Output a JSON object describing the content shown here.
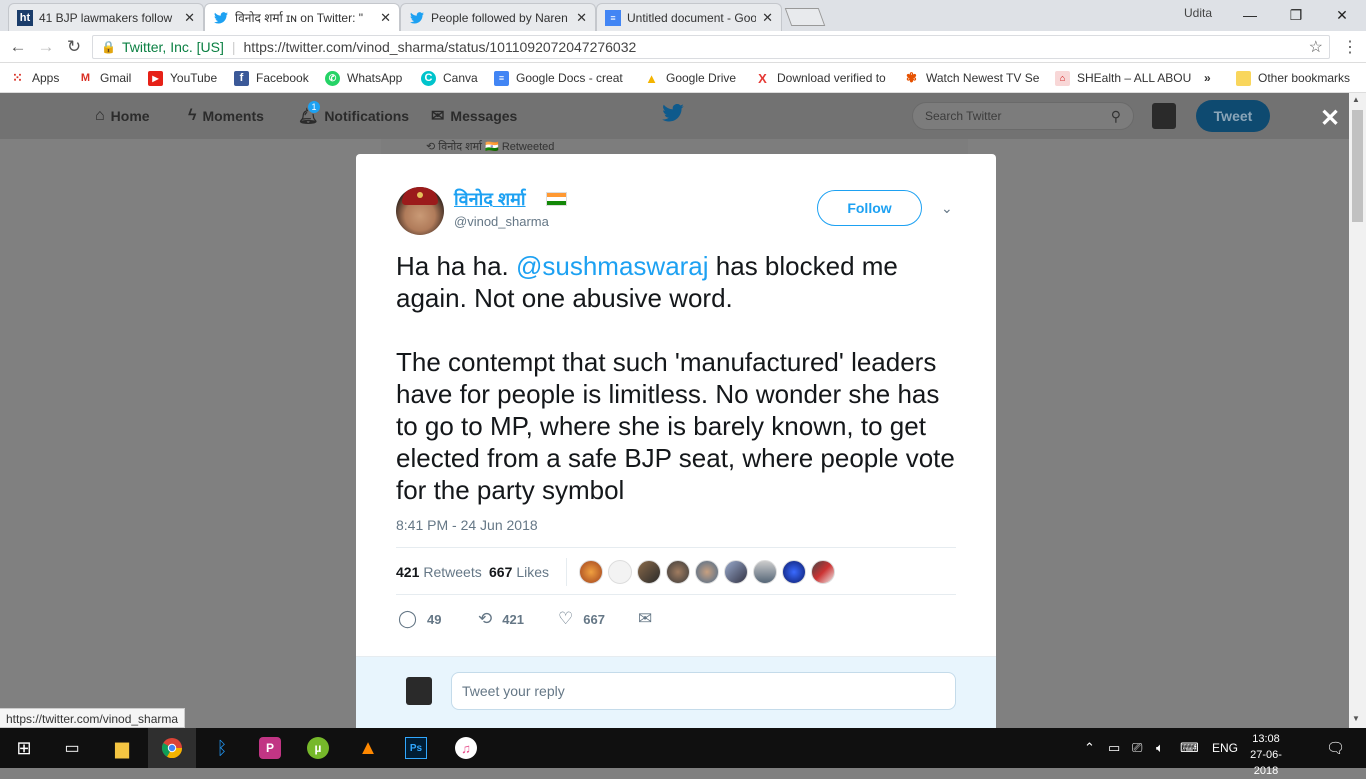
{
  "browser": {
    "tabs": [
      {
        "title": "41 BJP lawmakers follow",
        "favicon": "ht",
        "active": false
      },
      {
        "title": "विनोद शर्मा ɪɴ on Twitter: \"",
        "favicon": "twitter-bird",
        "active": true
      },
      {
        "title": "People followed by Naren",
        "favicon": "twitter-bird",
        "active": false
      },
      {
        "title": "Untitled document - Goo",
        "favicon": "docs",
        "active": false
      }
    ],
    "window_user": "Udita",
    "security_label": "Twitter, Inc. [US]",
    "url": "https://twitter.com/vinod_sharma/status/1011092072047276032",
    "bookmarks": [
      "Apps",
      "Gmail",
      "YouTube",
      "Facebook",
      "WhatsApp",
      "Canva",
      "Google Docs - creat",
      "Google Drive",
      "Download verified to",
      "Watch Newest TV Se",
      "SHEalth – ALL ABOU",
      "»",
      "Other bookmarks"
    ]
  },
  "twitter_nav": {
    "home": "Home",
    "moments": "Moments",
    "notifications": "Notifications",
    "notification_count": "1",
    "messages": "Messages",
    "search_placeholder": "Search Twitter",
    "tweet_button": "Tweet"
  },
  "behind_strip": "विनोद शर्मा 🇮🇳 Retweeted",
  "tweet": {
    "display_name": "विनोद शर्मा",
    "handle": "@vinod_sharma",
    "follow_label": "Follow",
    "text_before_mention": "Ha ha ha. ",
    "mention": "@sushmaswaraj",
    "text_after_mention": " has blocked me again. Not one abusive word.\n\nThe contempt that such 'manufactured' leaders have for people is limitless. No wonder she has to go to MP, where she is barely known, to get elected from a safe BJP seat, where people vote for the party symbol",
    "timestamp": "8:41 PM - 24 Jun 2018",
    "retweets_count": "421",
    "retweets_label": "Retweets",
    "likes_count": "667",
    "likes_label": "Likes",
    "actions": {
      "replies": "49",
      "retweets": "421",
      "likes": "667"
    },
    "reply_placeholder": "Tweet your reply"
  },
  "status_url": "https://twitter.com/vinod_sharma",
  "taskbar": {
    "language": "ENG",
    "time": "13:08",
    "date": "27-06-2018"
  },
  "colors": {
    "twitter_blue": "#1da1f2",
    "overlay_gray": "#808080",
    "secure_green": "#0b8043"
  }
}
